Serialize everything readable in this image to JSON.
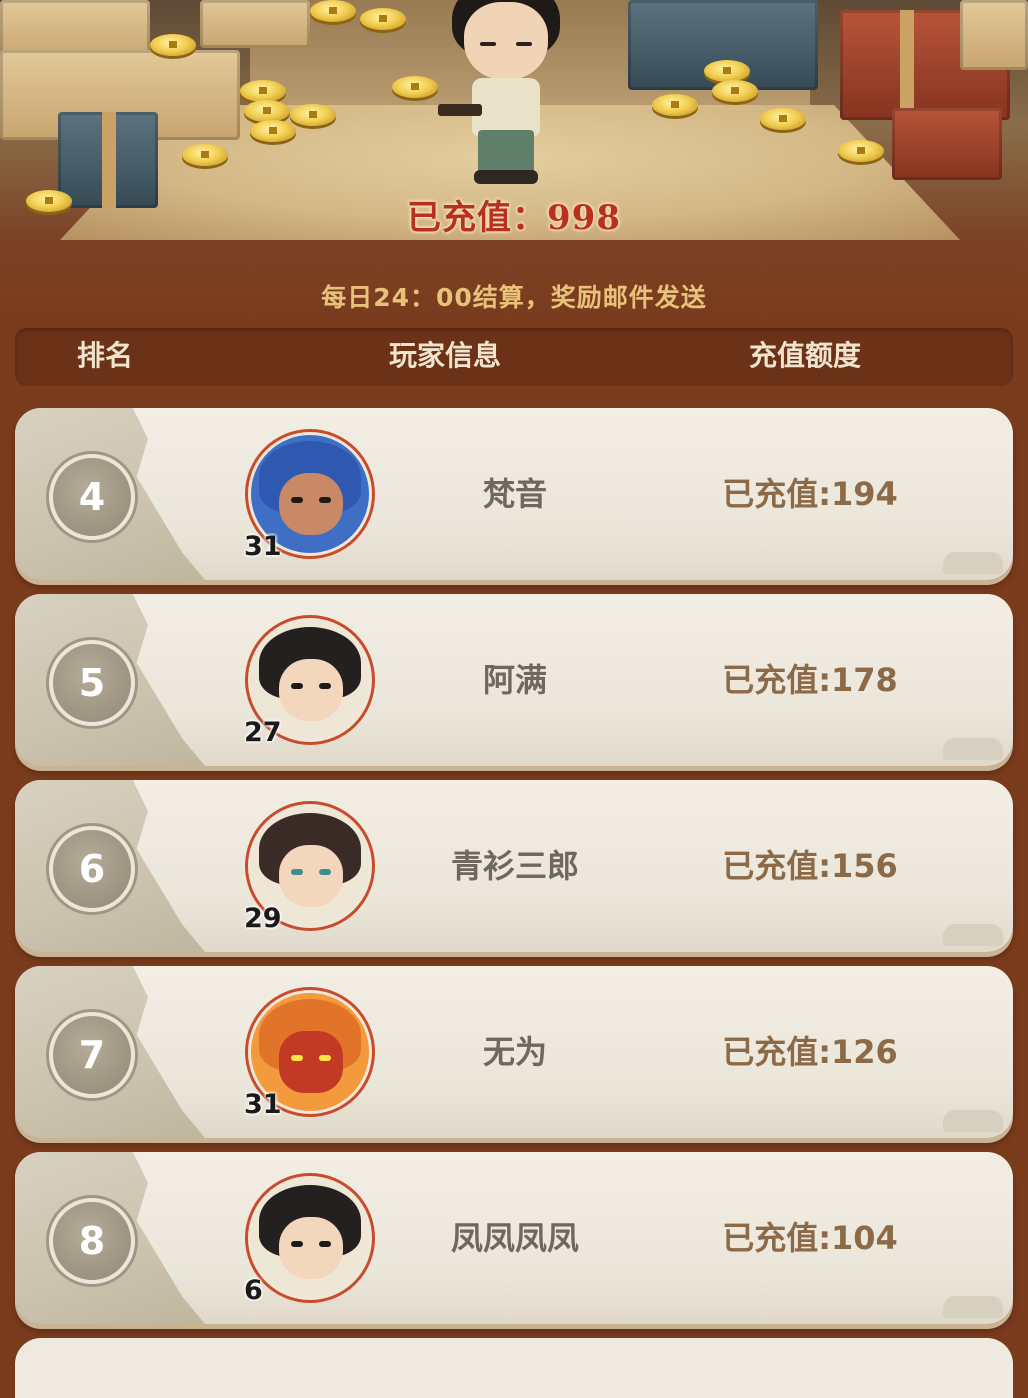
{
  "banner": {
    "recharged_total": "已充值：998",
    "settlement_note": "每日24：00结算，奖励邮件发送"
  },
  "table_header": {
    "rank": "排名",
    "player_info": "玩家信息",
    "recharge_amount": "充值额度"
  },
  "rows": [
    {
      "rank": "4",
      "level": "31",
      "name": "梵音",
      "amount": "已充值:194"
    },
    {
      "rank": "5",
      "level": "27",
      "name": "阿满",
      "amount": "已充值:178"
    },
    {
      "rank": "6",
      "level": "29",
      "name": "青衫三郎",
      "amount": "已充值:156"
    },
    {
      "rank": "7",
      "level": "31",
      "name": "无为",
      "amount": "已充值:126"
    },
    {
      "rank": "8",
      "level": "6",
      "name": "凤凤凤凤",
      "amount": "已充值:104"
    }
  ]
}
